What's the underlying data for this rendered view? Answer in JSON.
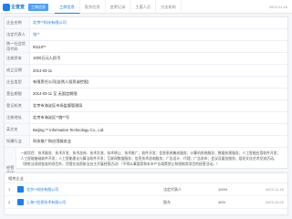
{
  "header": {
    "brand": "企查查",
    "pill": "工商信息",
    "tabs": [
      "工商信息",
      "股东信息",
      "变更记录",
      "主要人员",
      "分支机构"
    ],
    "timestamp": "2023-11-16"
  },
  "detail": {
    "rows": [
      {
        "label": "企业名称",
        "value": "北京**科技有限公司"
      },
      {
        "label": "法定代表人",
        "value": "张**"
      },
      {
        "label": "统一社会信用代码",
        "value": "91110**"
      },
      {
        "label": "注册资本",
        "value": "1000万元人民币"
      },
      {
        "label": "成立日期",
        "value": "2014-03-11"
      },
      {
        "label": "企业类型",
        "value": "有限责任公司(自然人投资或控股)"
      },
      {
        "label": "营业期限",
        "value": "2014-03-11 至 无固定期限"
      },
      {
        "label": "登记机关",
        "value": "北京市海淀区市场监督管理局"
      },
      {
        "label": "注册地址",
        "value": "北京市海淀区**路**号"
      },
      {
        "label": "英文名",
        "value": "Beijing ** Information Technology Co., Ltd."
      },
      {
        "label": "所属行业",
        "value": "科技推广和应用服务业"
      }
    ],
    "scope_label": "经营范围",
    "scope_text": "一般项目：技术服务、技术开发、技术咨询、技术交流、技术转让、技术推广；软件开发；信息系统集成服务；计算机系统服务；数据处理服务；人工智能应用软件开发；人工智能基础软件开发；人工智能理论与算法软件开发；互联网数据服务；信息技术咨询服务；广告设计、代理；广告发布；会议及展览服务；组织文化艺术交流活动。（除依法须经批准的项目外，凭营业执照依法自主开展经营活动）（不得从事国家和本市产业政策禁止和限制类项目的经营活动。）"
  },
  "list": {
    "title": "相关企业",
    "rows": [
      {
        "index": "1",
        "name": "北京**科技有限公司",
        "col3": "法定代表人",
        "col4": "100%",
        "date": "2023-11-16"
      },
      {
        "index": "2",
        "name": "上海**信息技术有限公司",
        "col3": "股东",
        "col4": "40%",
        "date": "2023-10-02"
      }
    ]
  }
}
